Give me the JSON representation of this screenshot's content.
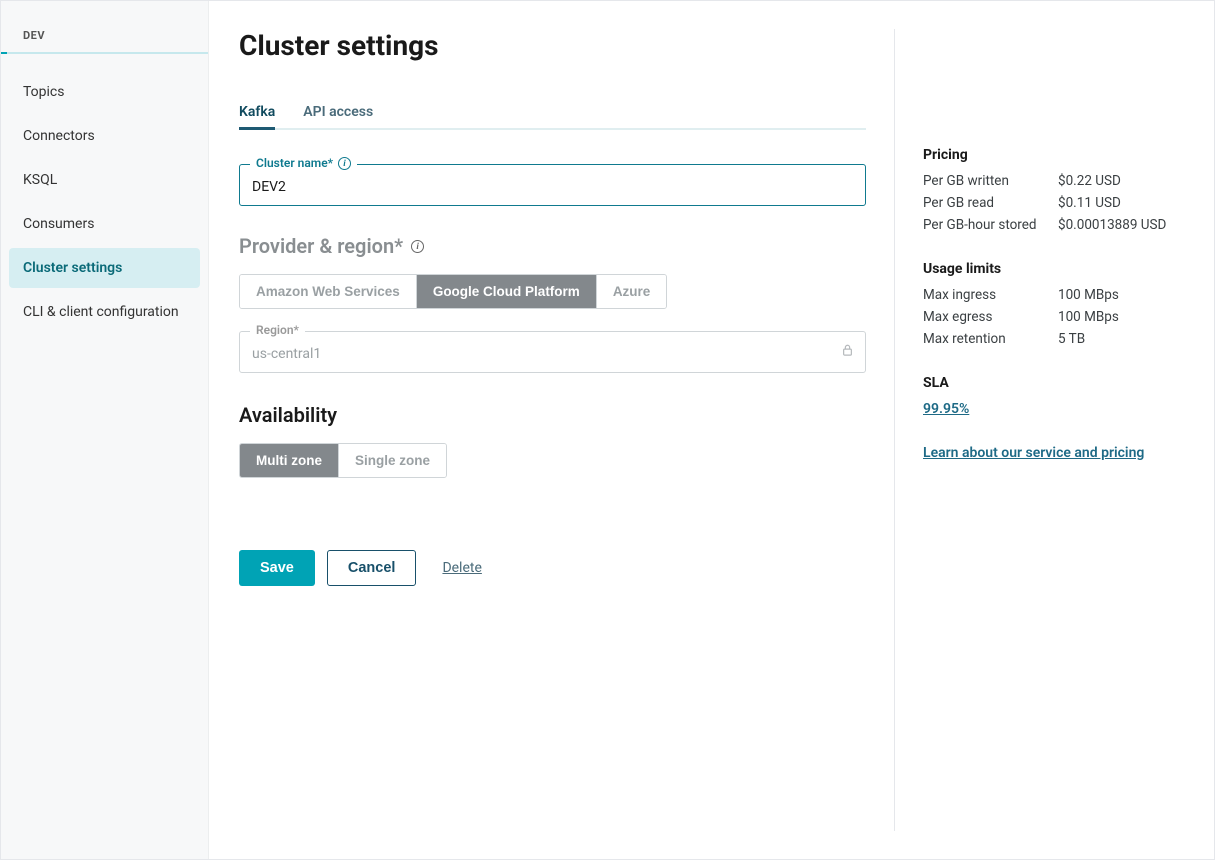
{
  "sidebar": {
    "header": "DEV",
    "items": [
      {
        "label": "Topics"
      },
      {
        "label": "Connectors"
      },
      {
        "label": "KSQL"
      },
      {
        "label": "Consumers"
      },
      {
        "label": "Cluster settings"
      },
      {
        "label": "CLI & client configuration"
      }
    ]
  },
  "page": {
    "title": "Cluster settings"
  },
  "tabs": [
    {
      "label": "Kafka"
    },
    {
      "label": "API access"
    }
  ],
  "cluster_name": {
    "label": "Cluster name*",
    "value": "DEV2"
  },
  "provider": {
    "title": "Provider & region*",
    "options": [
      {
        "label": "Amazon Web Services"
      },
      {
        "label": "Google Cloud Platform"
      },
      {
        "label": "Azure"
      }
    ],
    "region_label": "Region*",
    "region_value": "us-central1"
  },
  "availability": {
    "title": "Availability",
    "options": [
      {
        "label": "Multi zone"
      },
      {
        "label": "Single zone"
      }
    ]
  },
  "actions": {
    "save": "Save",
    "cancel": "Cancel",
    "delete": "Delete"
  },
  "pricing": {
    "heading": "Pricing",
    "rows": [
      {
        "k": "Per GB written",
        "v": "$0.22 USD"
      },
      {
        "k": "Per GB read",
        "v": "$0.11 USD"
      },
      {
        "k": "Per GB-hour stored",
        "v": "$0.00013889 USD"
      }
    ]
  },
  "usage": {
    "heading": "Usage limits",
    "rows": [
      {
        "k": "Max ingress",
        "v": "100 MBps"
      },
      {
        "k": "Max egress",
        "v": "100 MBps"
      },
      {
        "k": "Max retention",
        "v": "5 TB"
      }
    ]
  },
  "sla": {
    "heading": "SLA",
    "value": "99.95%"
  },
  "learn_link": "Learn about our service and pricing"
}
